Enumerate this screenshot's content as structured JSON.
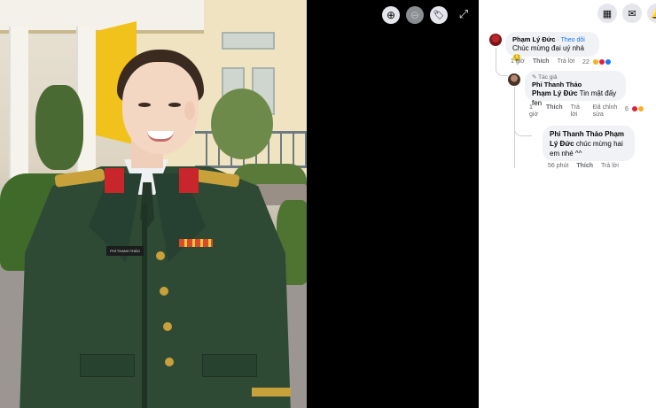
{
  "viewer": {
    "tools": [
      {
        "icon": "zoom-in-icon",
        "glyph": "⊕"
      },
      {
        "icon": "zoom-out-icon",
        "glyph": "⊖"
      },
      {
        "icon": "tag-icon",
        "glyph": "🏷"
      }
    ],
    "expand_glyph": "⤢",
    "photo": {
      "name_tag": "PHÍ THANH THẢO"
    }
  },
  "header": {
    "menu_glyph": "▦",
    "messenger_glyph": "✉",
    "notifications_glyph": "🔔"
  },
  "comments": [
    {
      "author": "Phạm Lý Đức",
      "follow": "Theo dõi",
      "text": "Chúc mừng đại uý nhá 🤤",
      "time": "1 giờ",
      "like": "Thích",
      "reply": "Trả lời",
      "reaction_count": "22"
    },
    {
      "author_badge": "Tác giả",
      "author": "Phi Thanh Thảo",
      "mention": "Phạm Lý Đức",
      "text": "Tin mật đấy fen",
      "time": "1 giờ",
      "like": "Thích",
      "reply": "Trả lời",
      "edited": "Đã chỉnh sửa",
      "reaction_count": "6"
    },
    {
      "author": "Phi Thanh Thảo",
      "mention": "Phạm Lý Đức",
      "text": "chúc mừng hai em nhé ^^",
      "time": "56 phút",
      "like": "Thích",
      "reply": "Trả lời"
    }
  ],
  "colors": {
    "link_blue": "#1877f2",
    "bubble_bg": "#f0f2f5",
    "meta_gray": "#65676b",
    "uniform_green": "#2e4a35"
  }
}
